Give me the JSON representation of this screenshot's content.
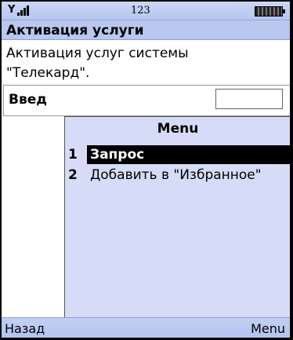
{
  "status": {
    "signal_label": "Y",
    "number": "123"
  },
  "title": "Активация услуги",
  "content": {
    "line1": "Активация услуг системы",
    "line2": "\"Телекард\".",
    "field_label": "Введ"
  },
  "menu": {
    "title": "Menu",
    "items": [
      {
        "num": "1",
        "label": "Запрос",
        "selected": true
      },
      {
        "num": "2",
        "label": "Добавить в \"Избранное\"",
        "selected": false
      }
    ]
  },
  "softkeys": {
    "left": "Назад",
    "right": "Menu"
  }
}
